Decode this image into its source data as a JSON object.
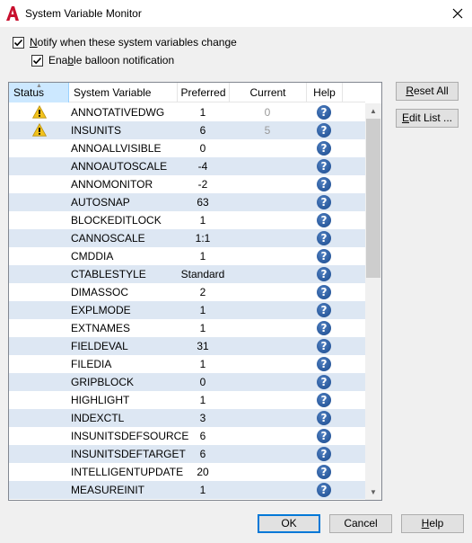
{
  "window": {
    "title": "System Variable Monitor",
    "close_glyph": "✕"
  },
  "options": {
    "notify_label": "Notify when these system variables change",
    "notify_checked": true,
    "balloon_label": "Enable balloon notification",
    "balloon_checked": true
  },
  "table": {
    "columns": [
      "Status",
      "System Variable",
      "Preferred",
      "Current",
      "Help"
    ],
    "rows": [
      {
        "status": "warning",
        "name": "ANNOTATIVEDWG",
        "preferred": "1",
        "current": "0"
      },
      {
        "status": "warning",
        "name": "INSUNITS",
        "preferred": "6",
        "current": "5"
      },
      {
        "status": "",
        "name": "ANNOALLVISIBLE",
        "preferred": "0",
        "current": ""
      },
      {
        "status": "",
        "name": "ANNOAUTOSCALE",
        "preferred": "-4",
        "current": ""
      },
      {
        "status": "",
        "name": "ANNOMONITOR",
        "preferred": "-2",
        "current": ""
      },
      {
        "status": "",
        "name": "AUTOSNAP",
        "preferred": "63",
        "current": ""
      },
      {
        "status": "",
        "name": "BLOCKEDITLOCK",
        "preferred": "1",
        "current": ""
      },
      {
        "status": "",
        "name": "CANNOSCALE",
        "preferred": "1:1",
        "current": ""
      },
      {
        "status": "",
        "name": "CMDDIA",
        "preferred": "1",
        "current": ""
      },
      {
        "status": "",
        "name": "CTABLESTYLE",
        "preferred": "Standard",
        "current": ""
      },
      {
        "status": "",
        "name": "DIMASSOC",
        "preferred": "2",
        "current": ""
      },
      {
        "status": "",
        "name": "EXPLMODE",
        "preferred": "1",
        "current": ""
      },
      {
        "status": "",
        "name": "EXTNAMES",
        "preferred": "1",
        "current": ""
      },
      {
        "status": "",
        "name": "FIELDEVAL",
        "preferred": "31",
        "current": ""
      },
      {
        "status": "",
        "name": "FILEDIA",
        "preferred": "1",
        "current": ""
      },
      {
        "status": "",
        "name": "GRIPBLOCK",
        "preferred": "0",
        "current": ""
      },
      {
        "status": "",
        "name": "HIGHLIGHT",
        "preferred": "1",
        "current": ""
      },
      {
        "status": "",
        "name": "INDEXCTL",
        "preferred": "3",
        "current": ""
      },
      {
        "status": "",
        "name": "INSUNITSDEFSOURCE",
        "preferred": "6",
        "current": ""
      },
      {
        "status": "",
        "name": "INSUNITSDEFTARGET",
        "preferred": "6",
        "current": ""
      },
      {
        "status": "",
        "name": "INTELLIGENTUPDATE",
        "preferred": "20",
        "current": ""
      },
      {
        "status": "",
        "name": "MEASUREINIT",
        "preferred": "1",
        "current": ""
      }
    ],
    "help_icon": "help-icon",
    "warning_icon": "warning-icon"
  },
  "side_buttons": {
    "reset_all": "Reset All",
    "edit_list": "Edit List ..."
  },
  "footer": {
    "ok": "OK",
    "cancel": "Cancel",
    "help": "Help"
  },
  "colors": {
    "title_icon": "#c8102e",
    "help_icon": "#1f5aa6",
    "warning_icon": "#f2c21b",
    "row_highlight": "#dde7f3",
    "header_selected": "#cce8ff"
  }
}
